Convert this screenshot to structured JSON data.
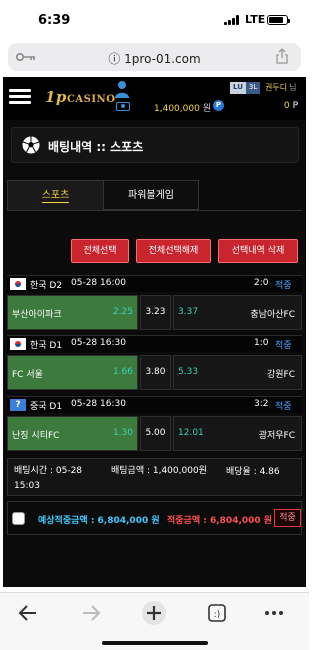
{
  "status_bar": {
    "time": "6:39",
    "carrier": "LTE"
  },
  "browser": {
    "url": "1pro-01.com"
  },
  "header": {
    "logo_prefix": "1p",
    "logo_text": "CASINO",
    "balance": "1,400,000",
    "balance_unit": "원",
    "point_badge": "P",
    "level_tag": "LU",
    "level_num": "3L",
    "username": "권두디",
    "username_suffix": "님",
    "points": "0",
    "points_unit": "P"
  },
  "page": {
    "title": "배팅내역 :: 스포츠"
  },
  "tabs": {
    "sports": "스포츠",
    "powerball": "파워볼게임"
  },
  "actions": {
    "select_all": "전체선택",
    "deselect_all": "전체선택해제",
    "delete_selected": "선택내역 삭제"
  },
  "matches": [
    {
      "league": "한국 D2",
      "datetime": "05-28 16:00",
      "score": "2:0",
      "result": "적중",
      "home_team": "부산아이파크",
      "home_odds": "2.25",
      "draw_odds": "3.23",
      "away_odds": "3.37",
      "away_team": "충남아산FC"
    },
    {
      "league": "한국 D1",
      "datetime": "05-28 16:30",
      "score": "1:0",
      "result": "적중",
      "home_team": "FC 서울",
      "home_odds": "1.66",
      "draw_odds": "3.80",
      "away_odds": "5.33",
      "away_team": "강원FC"
    },
    {
      "league": "중국 D1",
      "flag_mark": "?",
      "datetime": "05-28 16:30",
      "score": "3:2",
      "result": "적중",
      "home_team": "난징 시티FC",
      "home_odds": "1.30",
      "draw_odds": "5.00",
      "away_odds": "12.01",
      "away_team": "광저우FC"
    }
  ],
  "summary": {
    "bet_time": "배팅시간 : 05-28 15:03",
    "bet_amount": "배팅금액 : 1,400,000원",
    "odds": "배당율 : 4.86"
  },
  "totals": {
    "expected": "예상적중금액 : 6,804,000 원",
    "won": "적중금액 : 6,804,000 원",
    "hit_button": "적중"
  },
  "colors": {
    "winning_cell": "#3d7a3d",
    "odds_text": "#3fd0b4",
    "accent_yellow": "#f5d54a",
    "action_red": "#c8252e"
  }
}
